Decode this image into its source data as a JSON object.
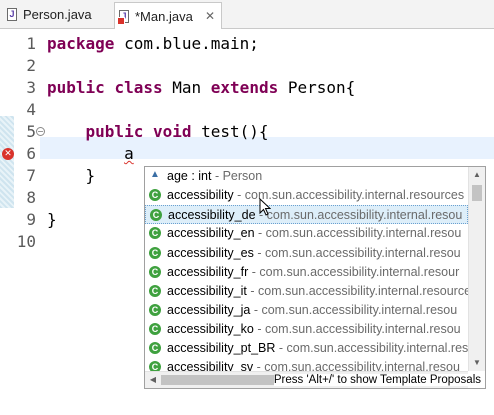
{
  "tabs": [
    {
      "label": "Person.java",
      "close": ""
    },
    {
      "label": "*Man.java",
      "close": "✕"
    }
  ],
  "editor": {
    "lines": [
      {
        "num": "1",
        "segments": [
          {
            "t": "package",
            "kw": true
          },
          {
            "t": " com.blue.main;",
            "kw": false
          }
        ]
      },
      {
        "num": "2",
        "segments": []
      },
      {
        "num": "3",
        "segments": [
          {
            "t": "public",
            "kw": true
          },
          {
            "t": " ",
            "kw": false
          },
          {
            "t": "class",
            "kw": true
          },
          {
            "t": " Man ",
            "kw": false
          },
          {
            "t": "extends",
            "kw": true
          },
          {
            "t": " Person{",
            "kw": false
          }
        ]
      },
      {
        "num": "4",
        "segments": []
      },
      {
        "num": "5",
        "segments": [
          {
            "t": "    ",
            "kw": false
          },
          {
            "t": "public",
            "kw": true
          },
          {
            "t": " ",
            "kw": false
          },
          {
            "t": "void",
            "kw": true
          },
          {
            "t": " test(){",
            "kw": false
          }
        ]
      },
      {
        "num": "6",
        "segments": [
          {
            "t": "        ",
            "kw": false
          },
          {
            "t": "a",
            "kw": false,
            "squiggle": true
          }
        ]
      },
      {
        "num": "7",
        "segments": [
          {
            "t": "    }",
            "kw": false
          }
        ]
      },
      {
        "num": "8",
        "segments": []
      },
      {
        "num": "9",
        "segments": [
          {
            "t": "}",
            "kw": false
          }
        ]
      },
      {
        "num": "10",
        "segments": []
      }
    ]
  },
  "assist": {
    "items": [
      {
        "name": "age : int",
        "pkg": " - Person",
        "icon": "field-icon"
      },
      {
        "name": "accessibility",
        "pkg": " - com.sun.accessibility.internal.resources",
        "icon": "class-icon"
      },
      {
        "name": "accessibility_de",
        "pkg": " - com.sun.accessibility.internal.resou",
        "icon": "class-icon"
      },
      {
        "name": "accessibility_en",
        "pkg": " - com.sun.accessibility.internal.resou",
        "icon": "class-icon"
      },
      {
        "name": "accessibility_es",
        "pkg": " - com.sun.accessibility.internal.resou",
        "icon": "class-icon"
      },
      {
        "name": "accessibility_fr",
        "pkg": " - com.sun.accessibility.internal.resour",
        "icon": "class-icon"
      },
      {
        "name": "accessibility_it",
        "pkg": " - com.sun.accessibility.internal.resource",
        "icon": "class-icon"
      },
      {
        "name": "accessibility_ja",
        "pkg": " - com.sun.accessibility.internal.resou",
        "icon": "class-icon"
      },
      {
        "name": "accessibility_ko",
        "pkg": " - com.sun.accessibility.internal.resou",
        "icon": "class-icon"
      },
      {
        "name": "accessibility_pt_BR",
        "pkg": " - com.sun.accessibility.internal.res",
        "icon": "class-icon"
      },
      {
        "name": "accessibility_sv",
        "pkg": " - com.sun.accessibility.internal.resou",
        "icon": "class-icon"
      }
    ],
    "selected_index": 2,
    "hint": "Press 'Alt+/' to show Template Proposals"
  },
  "colors": {
    "keyword": "#7f0055",
    "error": "#d9322b",
    "class_icon": "#3fa13f",
    "selection": "#ddeef9"
  }
}
